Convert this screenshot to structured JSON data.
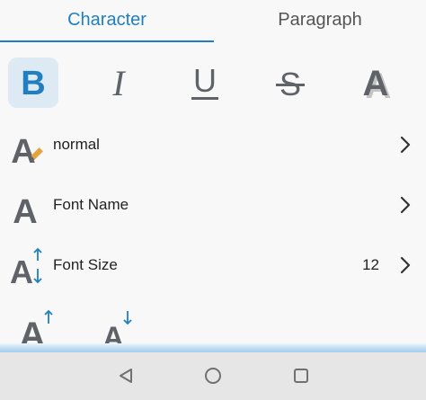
{
  "tabs": [
    {
      "label": "Character",
      "active": true
    },
    {
      "label": "Paragraph",
      "active": false
    }
  ],
  "format_toolbar": {
    "bold": {
      "glyph": "B",
      "icon": "bold-icon",
      "active": true
    },
    "italic": {
      "glyph": "I",
      "icon": "italic-icon",
      "active": false
    },
    "underline": {
      "glyph": "U",
      "icon": "underline-icon",
      "active": false
    },
    "strikethrough": {
      "glyph": "S",
      "icon": "strikethrough-icon",
      "active": false
    },
    "shadow": {
      "glyph": "A",
      "icon": "text-shadow-icon",
      "active": false
    }
  },
  "rows": {
    "style": {
      "label": "normal",
      "icon": "text-style-icon"
    },
    "font_name": {
      "label": "Font Name",
      "icon": "font-icon"
    },
    "font_size": {
      "label": "Font Size",
      "value": "12",
      "icon": "font-size-icon"
    }
  },
  "size_tools": {
    "grow": {
      "glyph": "A",
      "icon": "grow-font-icon"
    },
    "shrink": {
      "glyph": "A",
      "icon": "shrink-font-icon"
    }
  },
  "nav": {
    "back_icon": "nav-back-icon",
    "home_icon": "nav-home-icon",
    "recents_icon": "nav-recents-icon"
  },
  "colors": {
    "accent": "#1f7fc1",
    "active_button_bg": "#dde9f3",
    "icon_gray": "#5f6368",
    "pencil": "#e6a23c",
    "nav_bar": "#e6e6e6"
  }
}
